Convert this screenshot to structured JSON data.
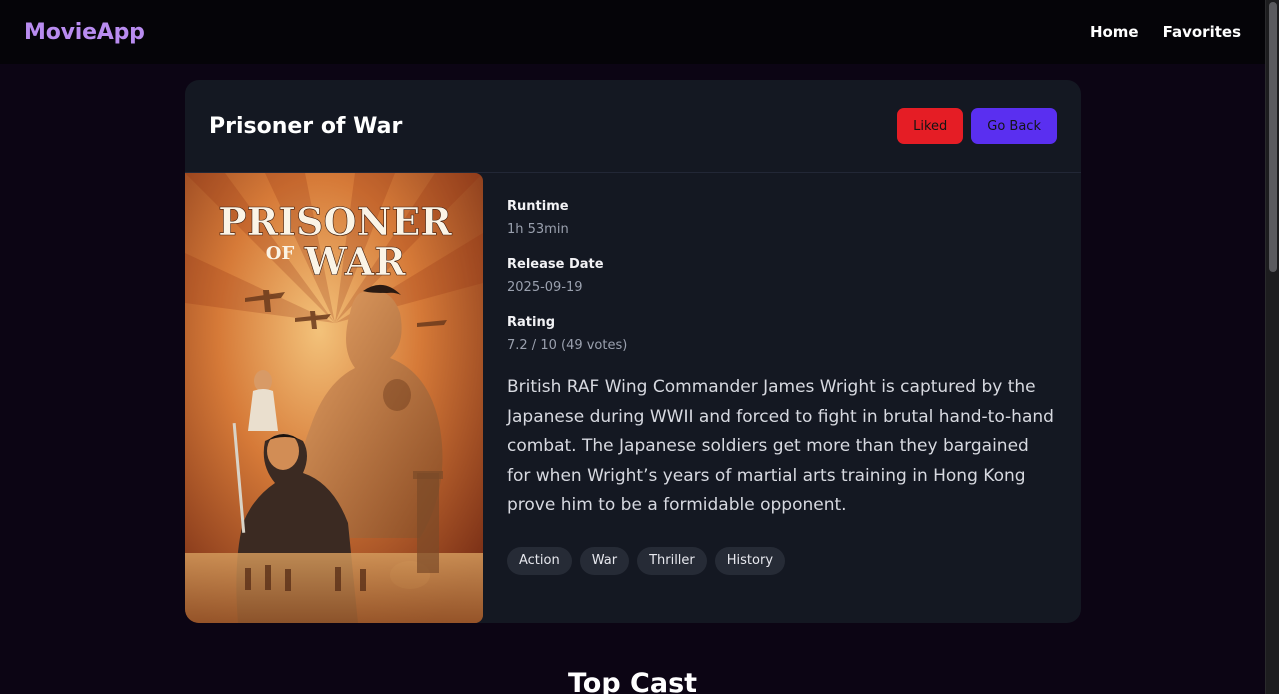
{
  "app": {
    "brand": "MovieApp"
  },
  "nav": {
    "home": "Home",
    "favorites": "Favorites"
  },
  "movie": {
    "title": "Prisoner of War",
    "liked_label": "Liked",
    "back_label": "Go Back",
    "poster": {
      "title_line1": "PRISONER",
      "title_line2_of": "OF",
      "title_line2_war": "WAR"
    },
    "fields": {
      "runtime_label": "Runtime",
      "runtime_value": "1h 53min",
      "release_label": "Release Date",
      "release_value": "2025-09-19",
      "rating_label": "Rating",
      "rating_value": "7.2 / 10 (49 votes)"
    },
    "overview": "British RAF Wing Commander James Wright is captured by the Japanese during WWII and forced to fight in brutal hand-to-hand combat. The Japanese soldiers get more than they bargained for when Wright’s years of martial arts training in Hong Kong prove him to be a formidable opponent.",
    "genres": [
      "Action",
      "War",
      "Thriller",
      "History"
    ]
  },
  "sections": {
    "top_cast": "Top Cast"
  },
  "colors": {
    "brand": "#b98cf0",
    "liked": "#e51d25",
    "back": "#5a2ff0",
    "card": "#141822",
    "page": "#0c0514"
  }
}
